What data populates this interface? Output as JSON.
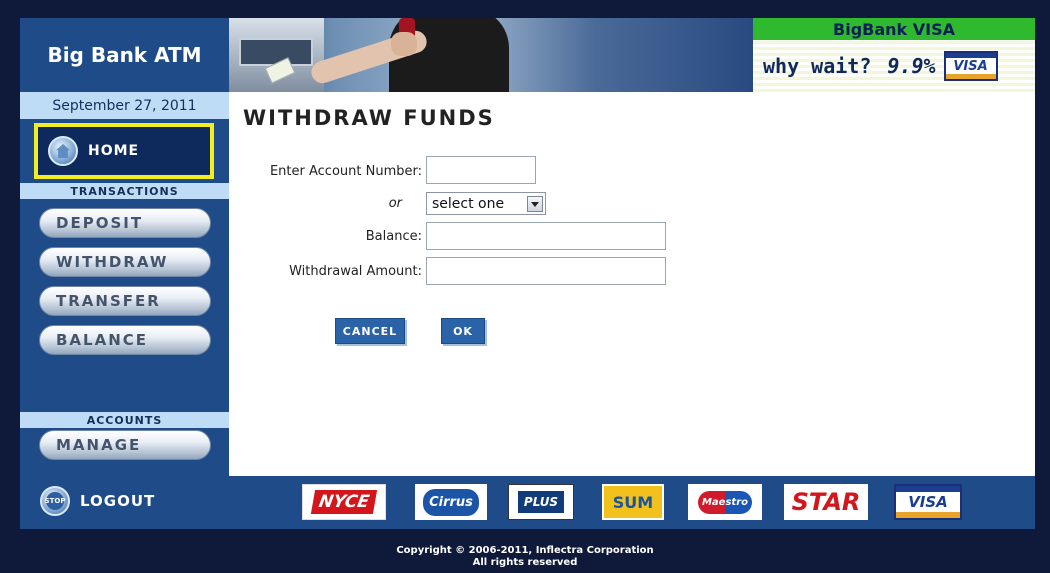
{
  "app": {
    "title": "Big Bank ATM"
  },
  "ad": {
    "headline": "BigBank VISA",
    "tagline": "why wait?",
    "rate": "9.9%",
    "card_label": "VISA"
  },
  "sidebar": {
    "date": "September 27, 2011",
    "home_label": "HOME",
    "transactions_header": "TRANSACTIONS",
    "items": [
      {
        "label": "DEPOSIT"
      },
      {
        "label": "WITHDRAW"
      },
      {
        "label": "TRANSFER"
      },
      {
        "label": "BALANCE"
      }
    ],
    "accounts_header": "ACCOUNTS",
    "manage_label": "MANAGE"
  },
  "main": {
    "title": "WITHDRAW FUNDS",
    "form": {
      "account_number_label": "Enter Account Number:",
      "account_number_value": "",
      "or_label": "or",
      "select_value": "select one",
      "balance_label": "Balance:",
      "balance_value": "",
      "withdrawal_label": "Withdrawal Amount:",
      "withdrawal_value": ""
    },
    "cancel_label": "CANCEL",
    "ok_label": "OK"
  },
  "footer": {
    "logout_label": "LOGOUT",
    "stop_icon_text": "STOP",
    "logos": {
      "nyce": "NYCE",
      "cirrus": "Cirrus",
      "plus": "PLUS",
      "sum": "SUM",
      "maestro": "Maestro",
      "star": "STAR",
      "visa": "VISA"
    },
    "copyright_line1": "Copyright © 2006-2011, Inflectra Corporation",
    "copyright_line2": "All rights reserved"
  },
  "colors": {
    "navy": "#1f4c88",
    "highlight": "#f3ec21",
    "button": "#2a63a8",
    "ad_green": "#2fb92f"
  }
}
